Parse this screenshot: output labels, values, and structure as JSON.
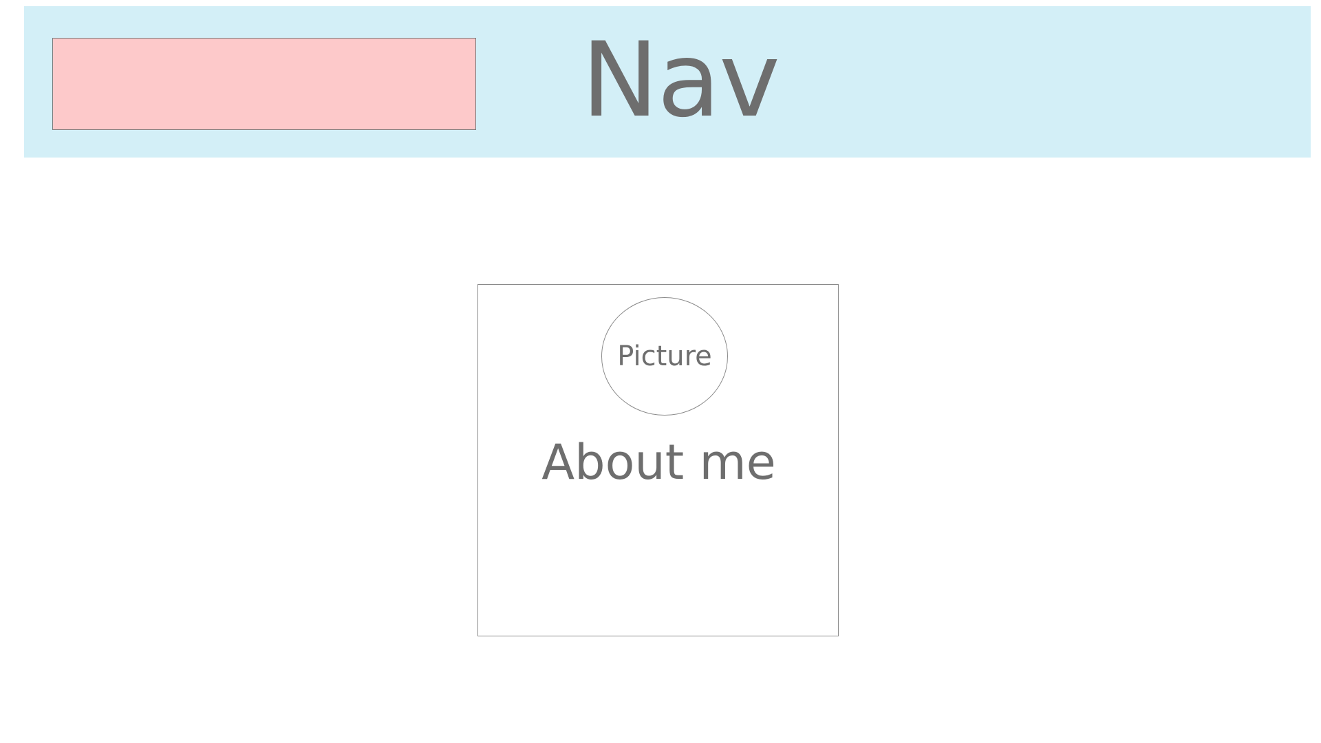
{
  "nav": {
    "title": "Nav",
    "logo_placeholder_color": "#fdc9ca",
    "background_color": "#d3eff7"
  },
  "profile": {
    "picture_label": "Picture",
    "title": "About me"
  },
  "colors": {
    "text": "#6e6e6e",
    "border": "#8a8a8a"
  }
}
